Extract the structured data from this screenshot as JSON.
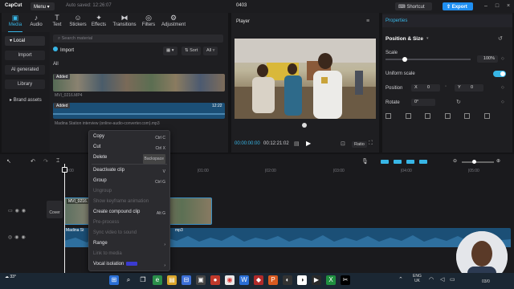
{
  "titlebar": {
    "app_name": "CapCut",
    "menu_label": "Menu",
    "saved_status": "Auto saved: 12:26:07",
    "project_title": "0403",
    "shortcut_label": "Shortcut",
    "export_label": "Export"
  },
  "media": {
    "tabs": [
      {
        "label": "Media",
        "icon": "media-icon"
      },
      {
        "label": "Audio",
        "icon": "audio-icon"
      },
      {
        "label": "Text",
        "icon": "text-icon"
      },
      {
        "label": "Stickers",
        "icon": "stickers-icon"
      },
      {
        "label": "Effects",
        "icon": "effects-icon"
      },
      {
        "label": "Transitions",
        "icon": "transitions-icon"
      },
      {
        "label": "Filters",
        "icon": "filters-icon"
      },
      {
        "label": "Adjustment",
        "icon": "adjustment-icon"
      }
    ],
    "side": {
      "local": "Local",
      "import": "Import",
      "ai_generated": "AI generated",
      "library": "Library",
      "brand_assets": "Brand assets"
    },
    "search_placeholder": "Search material",
    "import_label": "Import",
    "sort_label": "Sort",
    "all_filter": "All",
    "all_header": "All",
    "video_clip": {
      "badge": "Added",
      "name": "MVI_0216.MP4"
    },
    "audio_clip": {
      "badge": "Added",
      "duration": "12:22",
      "name": "Madina Station interview (online-audio-converter.com).mp3"
    }
  },
  "player": {
    "title": "Player",
    "current_time": "00:00:00:00",
    "total_time": "00:12:21:02",
    "ratio_label": "Ratio"
  },
  "properties": {
    "title": "Properties",
    "section": "Position & Size",
    "scale_label": "Scale",
    "scale_value": "100%",
    "uniform_scale": "Uniform scale",
    "position_label": "Position",
    "x_label": "X",
    "x_value": "0",
    "y_label": "Y",
    "y_value": "0",
    "rotate_label": "Rotate",
    "rotate_value": "0°"
  },
  "timeline": {
    "ticks": [
      "|00:00",
      "|01:00",
      "|02:00",
      "|03:00",
      "|04:00",
      "|05:00",
      "|06:00"
    ],
    "cover_label": "Cover",
    "video_track_label": "MVI_0216.",
    "audio_track_label": "Madina St",
    "audio_track_suffix": "mp3"
  },
  "context_menu": {
    "items": [
      {
        "label": "Copy",
        "key": "Ctrl C",
        "enabled": true
      },
      {
        "label": "Cut",
        "key": "Ctrl X",
        "enabled": true
      },
      {
        "label": "Delete",
        "key": "Backspace",
        "enabled": true
      },
      {
        "label": "Deactivate clip",
        "key": "V",
        "enabled": true
      },
      {
        "label": "Group",
        "key": "Ctrl G",
        "enabled": true
      },
      {
        "label": "Ungroup",
        "key": "",
        "enabled": false
      },
      {
        "label": "Show keyframe animation",
        "key": "",
        "enabled": false
      },
      {
        "label": "Create compound clip",
        "key": "Alt G",
        "enabled": true
      },
      {
        "label": "Pre-process",
        "key": "",
        "enabled": false
      },
      {
        "label": "Sync video to sound",
        "key": "",
        "enabled": false
      },
      {
        "label": "Range",
        "key": "›",
        "enabled": true
      },
      {
        "label": "Link to media",
        "key": "",
        "enabled": false
      },
      {
        "label": "Vocal isolation",
        "key": "›",
        "enabled": true
      }
    ]
  },
  "taskbar": {
    "weather": "33°",
    "lang_top": "ENG",
    "lang_bottom": "UK",
    "date": "03/0"
  },
  "colors": {
    "accent": "#1f8ff2",
    "tab_active": "#38b6e6",
    "audio_track": "#1b4f76"
  }
}
